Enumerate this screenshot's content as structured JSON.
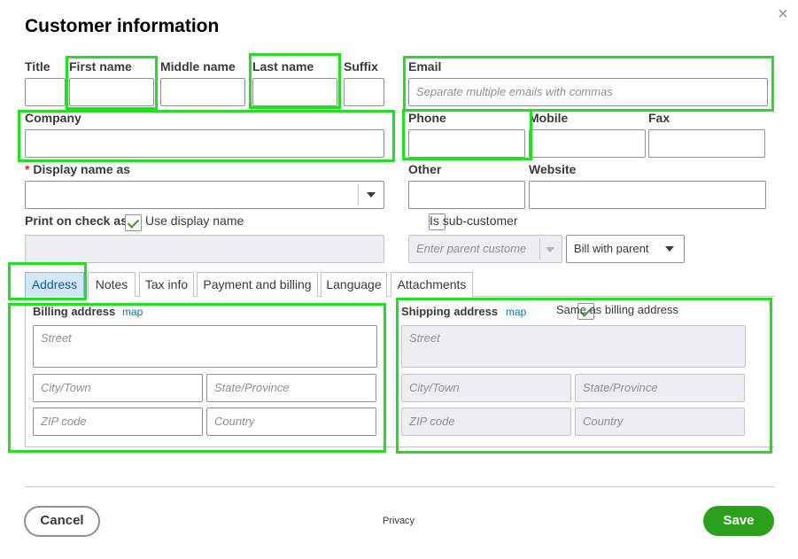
{
  "dialog": {
    "title": "Customer information",
    "close_glyph": "×"
  },
  "name_fields": {
    "title_label": "Title",
    "first_label": "First name",
    "middle_label": "Middle name",
    "last_label": "Last name",
    "suffix_label": "Suffix"
  },
  "email": {
    "label": "Email",
    "placeholder": "Separate multiple emails with commas"
  },
  "company": {
    "label": "Company"
  },
  "phone": {
    "label": "Phone"
  },
  "mobile": {
    "label": "Mobile"
  },
  "fax": {
    "label": "Fax"
  },
  "display_name": {
    "required_mark": "*",
    "label": "Display name as"
  },
  "other": {
    "label": "Other"
  },
  "website": {
    "label": "Website"
  },
  "print_on_check": {
    "label": "Print on check as",
    "checkbox_label": "Use display name",
    "checked": true
  },
  "sub_customer": {
    "label": "Is sub-customer",
    "checked": false,
    "parent_placeholder": "Enter parent custome",
    "bill_option": "Bill with parent"
  },
  "tabs": [
    {
      "label": "Address",
      "active": true
    },
    {
      "label": "Notes"
    },
    {
      "label": "Tax info"
    },
    {
      "label": "Payment and billing"
    },
    {
      "label": "Language"
    },
    {
      "label": "Attachments"
    }
  ],
  "billing": {
    "label": "Billing address",
    "map_link": "map",
    "street": "Street",
    "city": "City/Town",
    "state": "State/Province",
    "zip": "ZIP code",
    "country": "Country"
  },
  "shipping": {
    "label": "Shipping address",
    "map_link": "map",
    "same_as_billing": "Same as billing address",
    "same_checked": true,
    "street": "Street",
    "city": "City/Town",
    "state": "State/Province",
    "zip": "ZIP code",
    "country": "Country"
  },
  "footer": {
    "cancel": "Cancel",
    "privacy": "Privacy",
    "save": "Save"
  },
  "colors": {
    "highlight": "#22e01f",
    "primary_button": "#2ca01c",
    "link": "#0077c5",
    "required": "#d52b1e",
    "active_tab": "#d4e7f7"
  }
}
